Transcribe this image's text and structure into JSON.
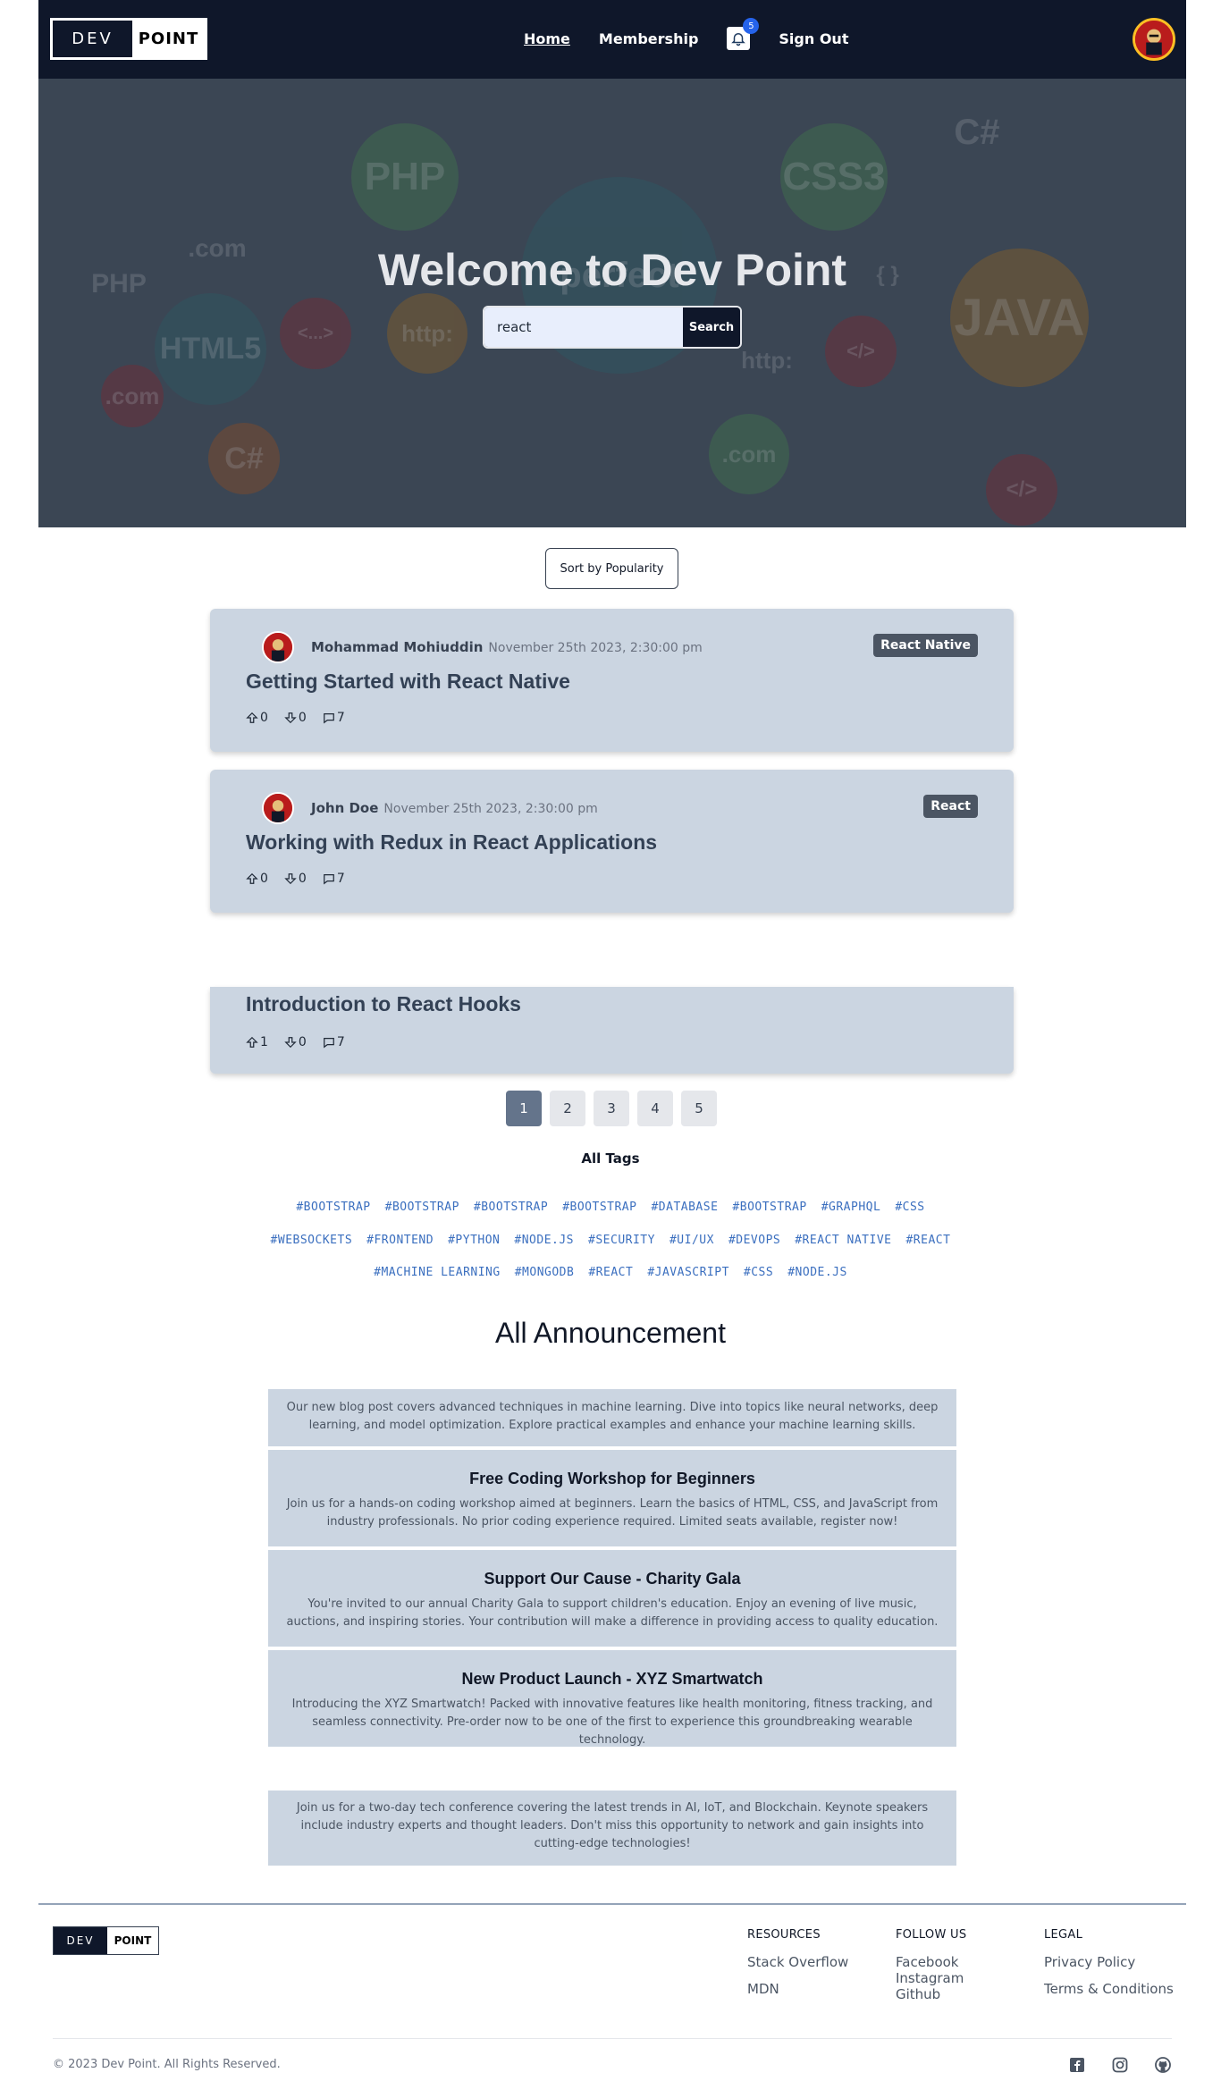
{
  "nav": {
    "logo_left": "DEV",
    "logo_right": "POINT",
    "links": [
      "Home",
      "Membership"
    ],
    "notifications_count": "5",
    "sign_out": "Sign Out"
  },
  "hero": {
    "title": "Welcome to Dev Point",
    "search_value": "react",
    "search_button": "Search"
  },
  "sort_button": "Sort by Popularity",
  "posts": [
    {
      "author": "Mohammad Mohiuddin",
      "date": "November 25th 2023, 2:30:00 pm",
      "tag": "React Native",
      "title": "Getting Started with React Native",
      "upvotes": "0",
      "downvotes": "0",
      "comments": "7"
    },
    {
      "author": "John Doe",
      "date": "November 25th 2023, 2:30:00 pm",
      "tag": "React",
      "title": "Working with Redux in React Applications",
      "upvotes": "0",
      "downvotes": "0",
      "comments": "7"
    },
    {
      "title": "Introduction to React Hooks",
      "upvotes": "1",
      "downvotes": "0",
      "comments": "7"
    }
  ],
  "pagination": [
    "1",
    "2",
    "3",
    "4",
    "5"
  ],
  "tags": {
    "title": "All Tags",
    "row1": [
      "#BOOTSTRAP",
      "#BOOTSTRAP",
      "#BOOTSTRAP",
      "#BOOTSTRAP",
      "#DATABASE",
      "#BOOTSTRAP",
      "#GRAPHQL",
      "#CSS"
    ],
    "row2": [
      "#WEBSOCKETS",
      "#FRONTEND",
      "#PYTHON",
      "#NODE.JS",
      "#SECURITY",
      "#UI/UX",
      "#DEVOPS",
      "#REACT NATIVE",
      "#REACT"
    ],
    "row3": [
      "#MACHINE LEARNING",
      "#MONGODB",
      "#REACT",
      "#JAVASCRIPT",
      "#CSS",
      "#NODE.JS"
    ]
  },
  "announcements": {
    "title": "All Announcement",
    "items": [
      {
        "title": "",
        "body": "Our new blog post covers advanced techniques in machine learning. Dive into topics like neural networks, deep learning, and model optimization. Explore practical examples and enhance your machine learning skills."
      },
      {
        "title": "Free Coding Workshop for Beginners",
        "body": "Join us for a hands-on coding workshop aimed at beginners. Learn the basics of HTML, CSS, and JavaScript from industry professionals. No prior coding experience required. Limited seats available, register now!"
      },
      {
        "title": "Support Our Cause - Charity Gala",
        "body": "You're invited to our annual Charity Gala to support children's education. Enjoy an evening of live music, auctions, and inspiring stories. Your contribution will make a difference in providing access to quality education."
      },
      {
        "title": "New Product Launch - XYZ Smartwatch",
        "body": "Introducing the XYZ Smartwatch! Packed with innovative features like health monitoring, fitness tracking, and seamless connectivity. Pre-order now to be one of the first to experience this groundbreaking wearable technology."
      },
      {
        "title": "",
        "body": "Join us for a two-day tech conference covering the latest trends in AI, IoT, and Blockchain. Keynote speakers include industry experts and thought leaders. Don't miss this opportunity to network and gain insights into cutting-edge technologies!"
      }
    ]
  },
  "footer": {
    "logo_left": "DEV",
    "logo_right": "POINT",
    "resources_title": "RESOURCES",
    "resources": [
      "Stack Overflow",
      "MDN"
    ],
    "follow_title": "FOLLOW US",
    "follow": [
      "Facebook",
      "Instagram",
      "Github"
    ],
    "legal_title": "LEGAL",
    "legal": [
      "Privacy Policy",
      "Terms & Conditions"
    ],
    "copyright": "© 2023 Dev Point. All Rights Reserved."
  },
  "hero_background_words": [
    "PHP",
    "CSS3",
    "C#",
    "JAVA",
    "HTML5",
    ".com",
    "http:",
    "perfect",
    "<...>",
    "</>",
    "{ }",
    "C#",
    ".com",
    "PHP",
    "http:",
    ".com",
    "</>"
  ]
}
